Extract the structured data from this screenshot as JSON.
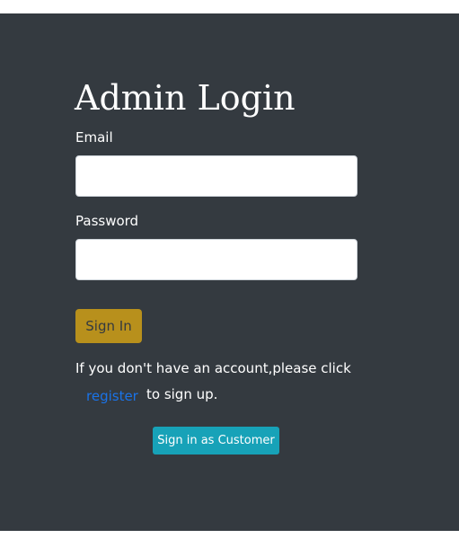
{
  "page": {
    "title": "Admin Login"
  },
  "form": {
    "email_label": "Email",
    "email_value": "",
    "password_label": "Password",
    "password_value": "",
    "sign_in_label": "Sign In"
  },
  "register_prompt": {
    "text_before": "If you don't have an account,please click",
    "link_label": "register",
    "text_after": "to sign up."
  },
  "customer_button": {
    "label": "Sign in as Customer"
  },
  "colors": {
    "panel_background": "#343a40",
    "sign_in_button": "#b8901c",
    "customer_button": "#17a2b8",
    "link": "#1a73e8"
  }
}
